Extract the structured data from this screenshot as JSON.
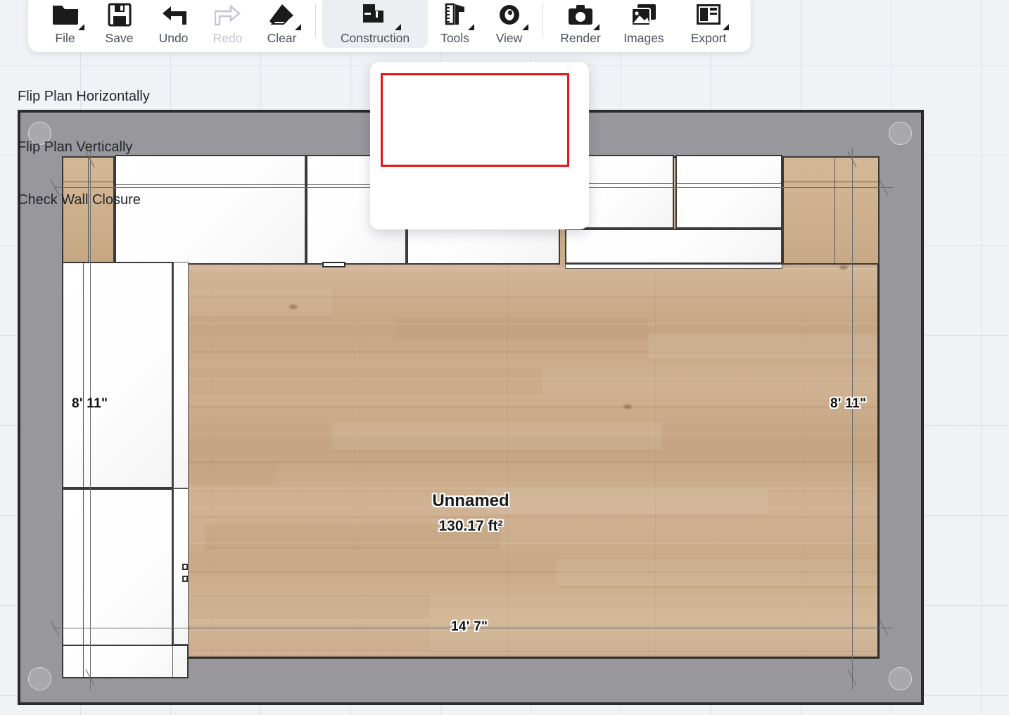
{
  "app": {
    "canvas_background": "#f1f2f6",
    "grid_color": "#cdd0da"
  },
  "toolbar": {
    "items": [
      {
        "id": "file",
        "label": "File",
        "icon": "folder-icon",
        "has_caret": true,
        "disabled": false,
        "active": false
      },
      {
        "id": "save",
        "label": "Save",
        "icon": "floppy-disk-icon",
        "has_caret": false,
        "disabled": false,
        "active": false
      },
      {
        "id": "undo",
        "label": "Undo",
        "icon": "undo-arrow-icon",
        "has_caret": false,
        "disabled": false,
        "active": false
      },
      {
        "id": "redo",
        "label": "Redo",
        "icon": "redo-arrow-icon",
        "has_caret": false,
        "disabled": true,
        "active": false
      },
      {
        "id": "clear",
        "label": "Clear",
        "icon": "eraser-icon",
        "has_caret": true,
        "disabled": false,
        "active": false
      },
      {
        "id": "construction",
        "label": "Construction",
        "icon": "construction-icon",
        "has_caret": true,
        "disabled": false,
        "active": true
      },
      {
        "id": "tools",
        "label": "Tools",
        "icon": "tools-icon",
        "has_caret": true,
        "disabled": false,
        "active": false
      },
      {
        "id": "view",
        "label": "View",
        "icon": "eye-icon",
        "has_caret": true,
        "disabled": false,
        "active": false
      },
      {
        "id": "render",
        "label": "Render",
        "icon": "camera-icon",
        "has_caret": true,
        "disabled": false,
        "active": false
      },
      {
        "id": "images",
        "label": "Images",
        "icon": "images-icon",
        "has_caret": false,
        "disabled": false,
        "active": false
      },
      {
        "id": "export",
        "label": "Export",
        "icon": "export-icon",
        "has_caret": true,
        "disabled": false,
        "active": false
      }
    ]
  },
  "construction_menu": {
    "open": true,
    "highlight_color": "#e81515",
    "items": [
      {
        "id": "flip-horizontal",
        "label": "Flip Plan Horizontally",
        "highlighted": true
      },
      {
        "id": "flip-vertical",
        "label": "Flip Plan Vertically",
        "highlighted": true
      },
      {
        "id": "check-closure",
        "label": "Check Wall Closure",
        "highlighted": false
      }
    ]
  },
  "floor_plan": {
    "room": {
      "name": "Unnamed",
      "area": "130.17 ft²"
    },
    "dimensions": {
      "left": "8' 11\"",
      "right": "8' 11\"",
      "bottom": "14' 7\""
    },
    "colors": {
      "wall_fill": "#98979c",
      "wall_stroke": "#2b2b2b",
      "floor_wood": "#c9ab8c",
      "cabinet_fill": "#ffffff",
      "cabinet_stroke": "#3a3a3a"
    }
  }
}
